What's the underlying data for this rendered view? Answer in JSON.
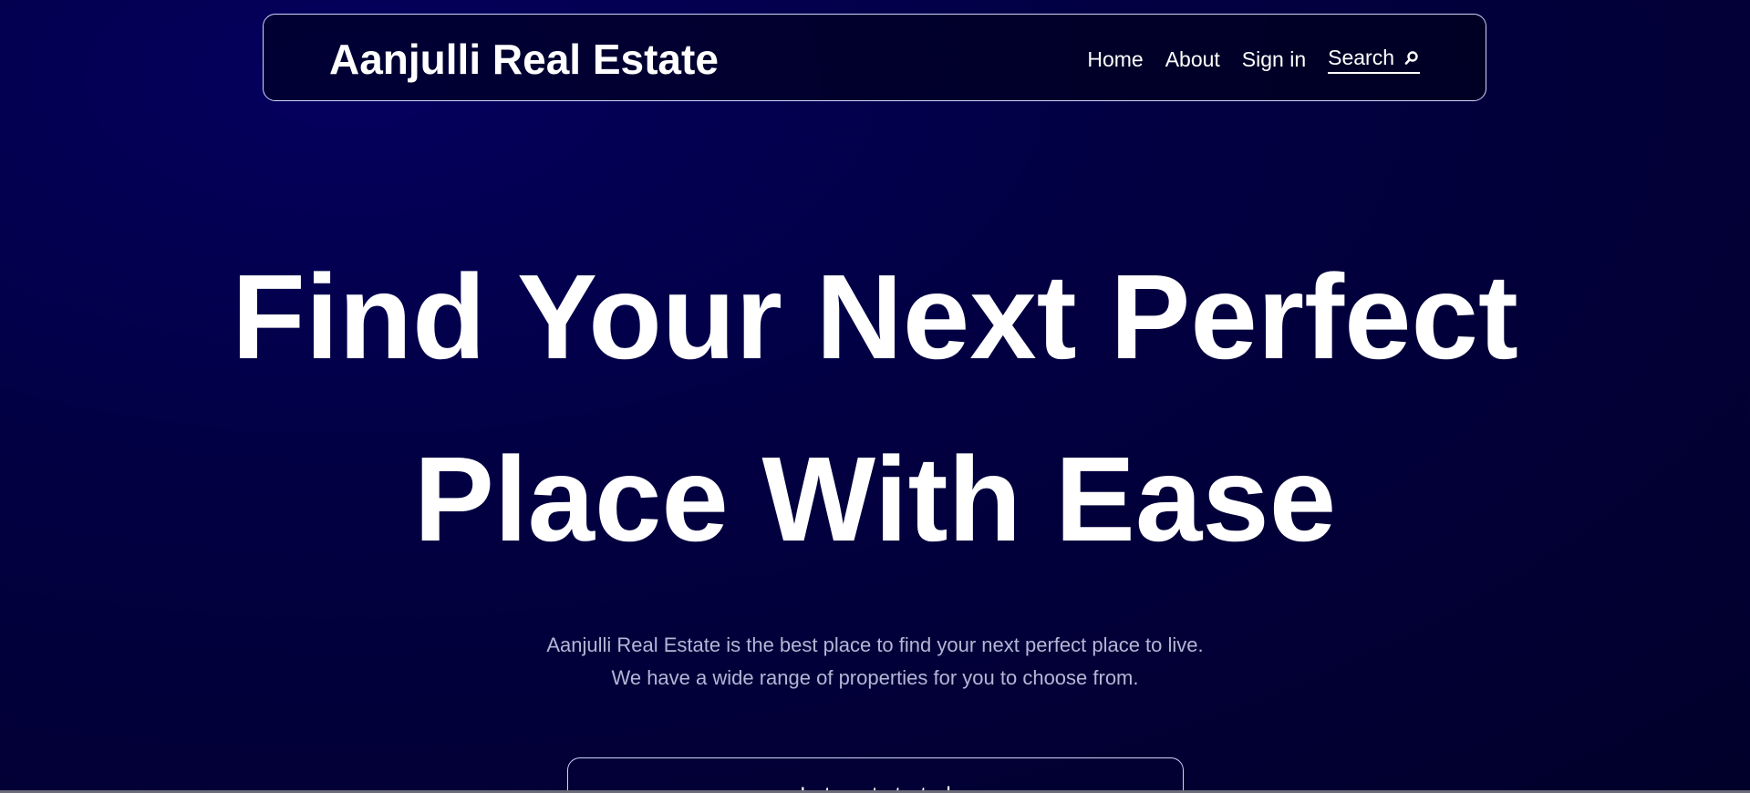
{
  "header": {
    "brand": "Aanjulli Real Estate",
    "nav": {
      "home": "Home",
      "about": "About",
      "signin": "Sign in",
      "search": "Search",
      "search_icon": "search-icon"
    }
  },
  "hero": {
    "title_line1": "Find Your Next Perfect",
    "title_line2": "Place With Ease",
    "subtitle_line1": "Aanjulli Real Estate is the best place to find your next perfect place to live.",
    "subtitle_line2": "We have a wide range of properties for you to choose from.",
    "cta_label": "Lets get started"
  },
  "colors": {
    "background": "#020042",
    "text": "#ffffff",
    "muted_text": "#b3b6d6",
    "border": "#cfd3ff"
  }
}
